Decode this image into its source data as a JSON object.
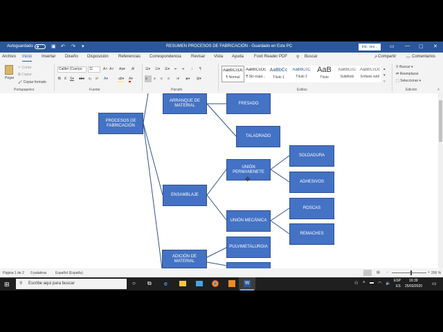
{
  "window": {
    "autosave_label": "Autoguardado",
    "title": "RESUMEN PROCESOS DE FABRICACIÓN -  Guardado en Este PC",
    "signin_label": "Inic. ses..."
  },
  "menu": {
    "tabs": [
      "Archivo",
      "Inicio",
      "Insertar",
      "Diseño",
      "Disposición",
      "Referencias",
      "Correspondencia",
      "Revisar",
      "Vista",
      "Ayuda",
      "Foxit Reader PDF"
    ],
    "search_label": "Buscar",
    "share_label": "Compartir",
    "comments_label": "Comentarios"
  },
  "ribbon": {
    "clipboard": {
      "paste": "Pegar",
      "cut": "Cortar",
      "copy": "Copiar",
      "format_painter": "Copiar formato",
      "label": "Portapapeles"
    },
    "font": {
      "family": "Calibri (Cuerpo",
      "size": "11",
      "label": "Fuente"
    },
    "paragraph": {
      "label": "Párrafo"
    },
    "styles": {
      "label": "Estilos",
      "items": [
        {
          "sample": "AaBbCcDc",
          "name": "¶ Normal"
        },
        {
          "sample": "AaBbCcDc",
          "name": "¶ Sin espa..."
        },
        {
          "sample": "AaBbCc",
          "name": "Título 1"
        },
        {
          "sample": "AaBbCcC",
          "name": "Título 2"
        },
        {
          "sample": "AaB",
          "name": "Título"
        },
        {
          "sample": "AaBbCcC",
          "name": "Subtítulo"
        },
        {
          "sample": "AaBbCcDc",
          "name": "Énfasis sutil"
        }
      ]
    },
    "editing": {
      "find": "Buscar",
      "replace": "Reemplazar",
      "select": "Seleccionar",
      "label": "Edición"
    }
  },
  "diagram": {
    "root": "PROCESOS DE FABRICACIÓN",
    "arranque": "ARRANQUE DE MATERIAL",
    "fresado": "FRESADO",
    "taladrado": "TALADRADO",
    "ensamblaje": "ENSAMBLAJE",
    "union_perm": "UNIÓN PERMANENETE",
    "soldadura": "SOLDADURA",
    "adhesivos": "ADHESIVOS",
    "union_mec": "UNIÓN MECÁNICA",
    "roscas": "ROSCAS",
    "remaches": "REMACHES",
    "adicion": "ADICIÓN DE MATERIAL",
    "pulvi": "PULVIMETALURGIA"
  },
  "status": {
    "page": "Página 1 de 2",
    "words": "0 palabras",
    "language": "Español (España)",
    "zoom": "200 %"
  },
  "taskbar": {
    "search_placeholder": "Escribe aquí para buscar",
    "lang_top": "ESP",
    "lang_bottom": "ES",
    "time": "16:39",
    "date": "25/03/2020"
  }
}
